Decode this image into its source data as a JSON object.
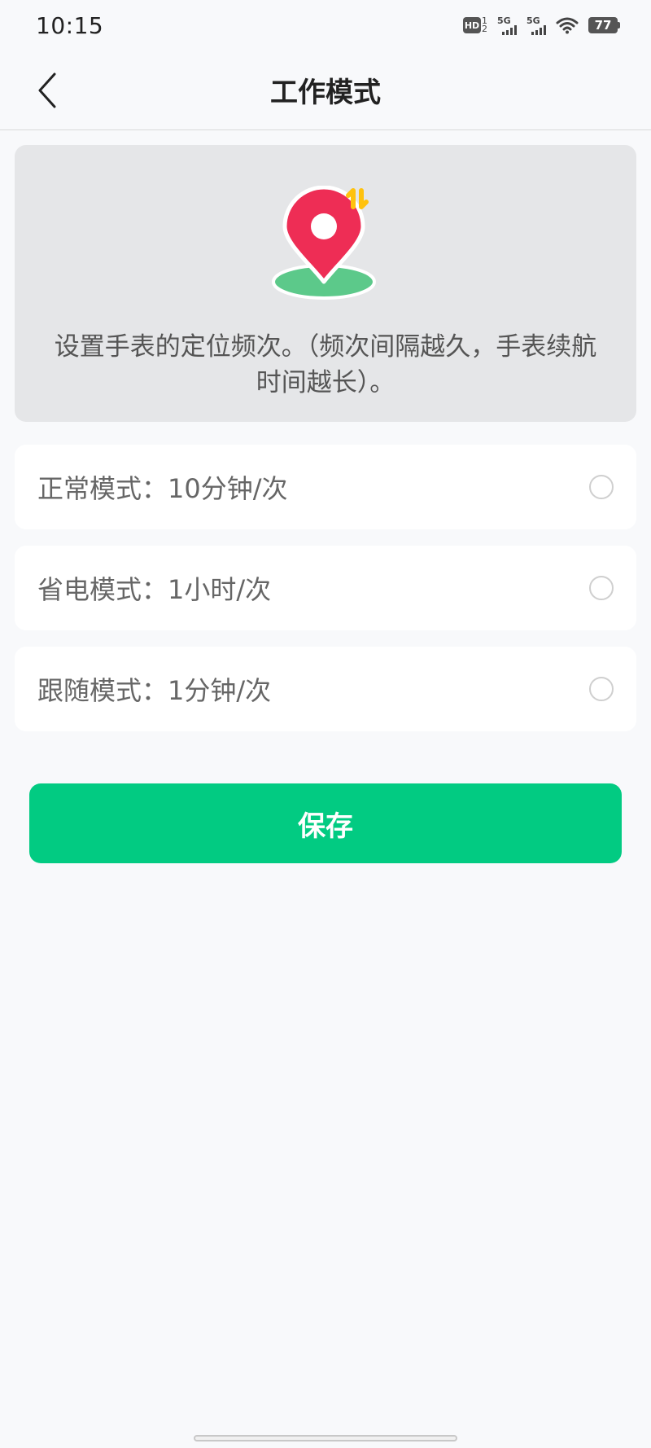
{
  "status_bar": {
    "time": "10:15",
    "hd_label": "HD",
    "hd_sub_top": "1",
    "hd_sub_bottom": "2",
    "sim1_label": "5G",
    "sim2_label": "5G",
    "battery": "77",
    "icons": [
      "hd-icon",
      "signal-icon",
      "signal-icon",
      "wifi-icon",
      "battery-icon"
    ]
  },
  "nav": {
    "back_icon": "chevron-left-icon",
    "title": "工作模式"
  },
  "info_card": {
    "illustration": "location-pin-icon",
    "description": "设置手表的定位频次。（频次间隔越久，手表续航时间越长）。"
  },
  "options": [
    {
      "label": "正常模式：10分钟/次",
      "selected": false
    },
    {
      "label": "省电模式：1小时/次",
      "selected": false
    },
    {
      "label": "跟随模式：1分钟/次",
      "selected": false
    }
  ],
  "save_button": {
    "label": "保存"
  },
  "colors": {
    "accent": "#02cb82",
    "pin_red": "#ee2d55",
    "ground_green": "#5cc98a",
    "arrow_yellow": "#ffc20e",
    "page_bg": "#f8f9fb",
    "card_bg": "#e5e6e8"
  }
}
